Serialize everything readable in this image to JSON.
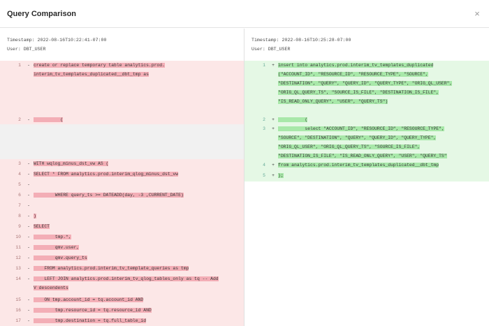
{
  "window": {
    "title": "Query Comparison",
    "close_glyph": "×"
  },
  "left": {
    "timestamp": "Timestamp: 2022-08-16T10:22:41-07:00",
    "user": "User: DBT_USER"
  },
  "right": {
    "timestamp": "Timestamp: 2022-08-16T10:25:28-07:00",
    "user": "User: DBT_USER"
  },
  "colors": {
    "deleted_bg": "#fce7e7",
    "deleted_highlight": "#f3aeb6",
    "added_bg": "#e5f8e5",
    "added_highlight": "#a8e8a9",
    "empty_bg": "#f1f1f1"
  },
  "diff_left": [
    {
      "num": "1",
      "sign": "-",
      "type": "del",
      "code": "create or replace temporary table analytics.prod.\ninterim_tv_templates_duplicated__dbt_tmp as",
      "h": 78
    },
    {
      "num": "2",
      "sign": "-",
      "type": "del",
      "code": "          (",
      "h": 12
    },
    {
      "num": "",
      "sign": "",
      "type": "empty",
      "code": "",
      "h": 50
    },
    {
      "num": "3",
      "sign": "-",
      "type": "del",
      "code": "WITH wqlog_minus_dst_vw AS (",
      "h": 15
    },
    {
      "num": "4",
      "sign": "-",
      "type": "del",
      "code": "SELECT * FROM analytics.prod.interim_qlog_minus_dst_vw",
      "h": 15
    },
    {
      "num": "5",
      "sign": "-",
      "type": "del",
      "code": "",
      "h": 15
    },
    {
      "num": "6",
      "sign": "-",
      "type": "del",
      "code": "        WHERE query_ts >= DATEADD(day, -3 ,CURRENT_DATE)",
      "h": 15
    },
    {
      "num": "7",
      "sign": "-",
      "type": "del",
      "code": "",
      "h": 15
    },
    {
      "num": "8",
      "sign": "-",
      "type": "del",
      "code": ")",
      "h": 15
    },
    {
      "num": "9",
      "sign": "-",
      "type": "del",
      "code": "SELECT",
      "h": 15
    },
    {
      "num": "10",
      "sign": "-",
      "type": "del",
      "code": "        tmp.*,",
      "h": 15
    },
    {
      "num": "11",
      "sign": "-",
      "type": "del",
      "code": "        qmv.user,",
      "h": 15
    },
    {
      "num": "12",
      "sign": "-",
      "type": "del",
      "code": "        qmv.query_ts",
      "h": 15
    },
    {
      "num": "13",
      "sign": "-",
      "type": "del",
      "code": "    FROM analytics.prod.interim_tv_template_queries as tmp",
      "h": 15
    },
    {
      "num": "14",
      "sign": "-",
      "type": "del",
      "code": "    LEFT JOIN analytics.prod.interim_tv_qlog_tables_only as tq -- Add\nV descendents",
      "h": 30
    },
    {
      "num": "15",
      "sign": "-",
      "type": "del",
      "code": "    ON tmp.account_id = tq.account_id AND",
      "h": 15
    },
    {
      "num": "16",
      "sign": "-",
      "type": "del",
      "code": "        tmp.resource_id = tq.resource_id AND",
      "h": 15
    },
    {
      "num": "17",
      "sign": "-",
      "type": "del",
      "code": "        tmp.destination = tq.full_table_id",
      "h": 15
    }
  ],
  "diff_right": [
    {
      "num": "1",
      "sign": "+",
      "type": "add",
      "code": "insert into analytics.prod.interim_tv_templates_duplicated\n(\"ACCOUNT_ID\", \"RESOURCE_ID\", \"RESOURCE_TYPE\", \"SOURCE\",\n\"DESTINATION\", \"QUERY\", \"QUERY_ID\", \"QUERY_TYPE\", \"ORIG_QL_USER\",\n\"ORIG_QL_QUERY_TS\", \"SOURCE_IS_FILE\", \"DESTINATION_IS_FILE\",\n\"IS_READ_ONLY_QUERY\", \"USER\", \"QUERY_TS\")",
      "h": 78
    },
    {
      "num": "2",
      "sign": "+",
      "type": "add",
      "code": "          (",
      "h": 12
    },
    {
      "num": "3",
      "sign": "+",
      "type": "add",
      "code": "          select \"ACCOUNT_ID\", \"RESOURCE_ID\", \"RESOURCE_TYPE\",\n\"SOURCE\", \"DESTINATION\", \"QUERY\", \"QUERY_ID\", \"QUERY_TYPE\",\n\"ORIG_QL_USER\", \"ORIG_QL_QUERY_TS\", \"SOURCE_IS_FILE\",\n\"DESTINATION_IS_FILE\", \"IS_READ_ONLY_QUERY\", \"USER\", \"QUERY_TS\"",
      "h": 50
    },
    {
      "num": "4",
      "sign": "+",
      "type": "add",
      "code": "from analytics.prod.interim_tv_templates_duplicated__dbt_tmp",
      "h": 15
    },
    {
      "num": "5",
      "sign": "+",
      "type": "add",
      "code": ");",
      "h": 15
    }
  ]
}
